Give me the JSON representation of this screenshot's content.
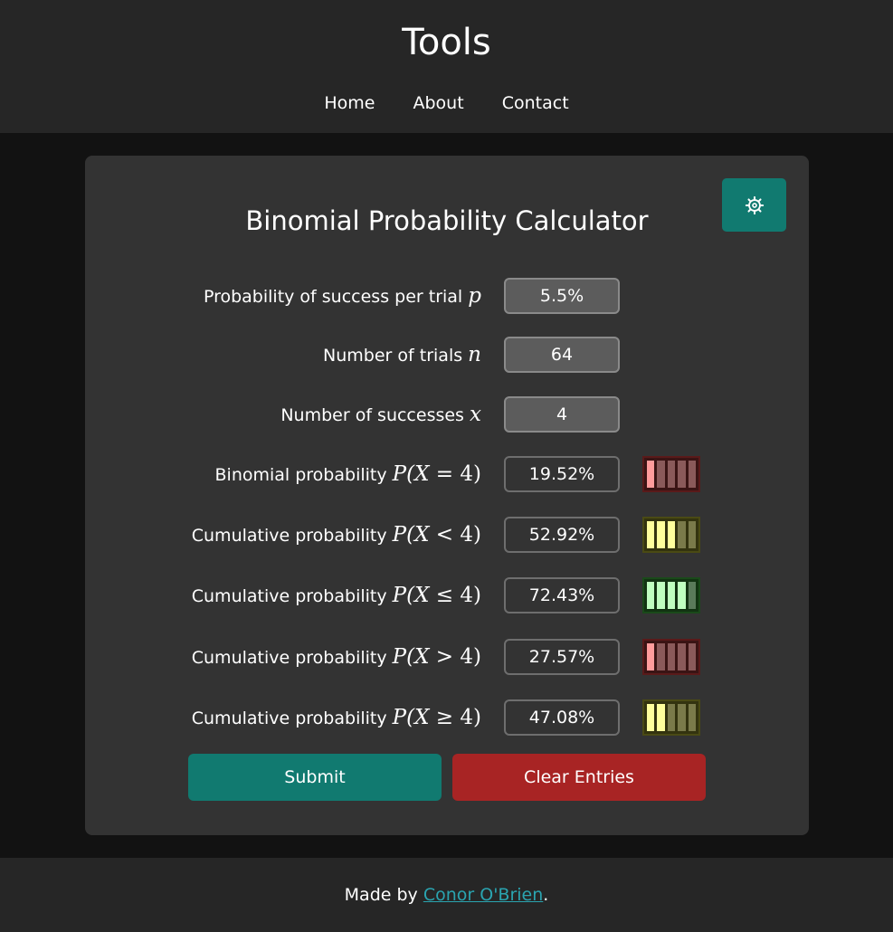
{
  "header": {
    "title": "Tools",
    "nav": [
      {
        "label": "Home"
      },
      {
        "label": "About"
      },
      {
        "label": "Contact"
      }
    ]
  },
  "calculator": {
    "title": "Binomial Probability Calculator",
    "settings_icon": "gear-icon",
    "inputs": [
      {
        "label": "Probability of success per trial",
        "symbol": "p",
        "value": "5.5%"
      },
      {
        "label": "Number of trials",
        "symbol": "n",
        "value": "64"
      },
      {
        "label": "Number of successes",
        "symbol": "x",
        "value": "4"
      }
    ],
    "results": [
      {
        "label": "Binomial probability",
        "expr_pre": "P(X ",
        "op": "=",
        "expr_post": " 4)",
        "value": "19.52%",
        "level": 1,
        "color": "red"
      },
      {
        "label": "Cumulative probability",
        "expr_pre": "P(X ",
        "op": "<",
        "expr_post": " 4)",
        "value": "52.92%",
        "level": 3,
        "color": "yellow"
      },
      {
        "label": "Cumulative probability",
        "expr_pre": "P(X ",
        "op": "≤",
        "expr_post": " 4)",
        "value": "72.43%",
        "level": 4,
        "color": "green"
      },
      {
        "label": "Cumulative probability",
        "expr_pre": "P(X ",
        "op": ">",
        "expr_post": " 4)",
        "value": "27.57%",
        "level": 1,
        "color": "red"
      },
      {
        "label": "Cumulative probability",
        "expr_pre": "P(X ",
        "op": "≥",
        "expr_post": " 4)",
        "value": "47.08%",
        "level": 2,
        "color": "yellow"
      }
    ],
    "meter_segments": 5,
    "submit_label": "Submit",
    "clear_label": "Clear Entries"
  },
  "colors": {
    "accent": "#117a70",
    "danger": "#a82424",
    "red": {
      "border": "#5a1a1a",
      "bg": "#3a1414",
      "on": "#ff9c9c",
      "off": "#8a5a5a"
    },
    "yellow": {
      "border": "#4a4a14",
      "bg": "#33330f",
      "on": "#ffff9c",
      "off": "#7a7a4a"
    },
    "green": {
      "border": "#1a4a1a",
      "bg": "#123312",
      "on": "#bfffbf",
      "off": "#5a7a5a"
    }
  },
  "footer": {
    "prefix": "Made by ",
    "author": "Conor O'Brien",
    "suffix": "."
  }
}
